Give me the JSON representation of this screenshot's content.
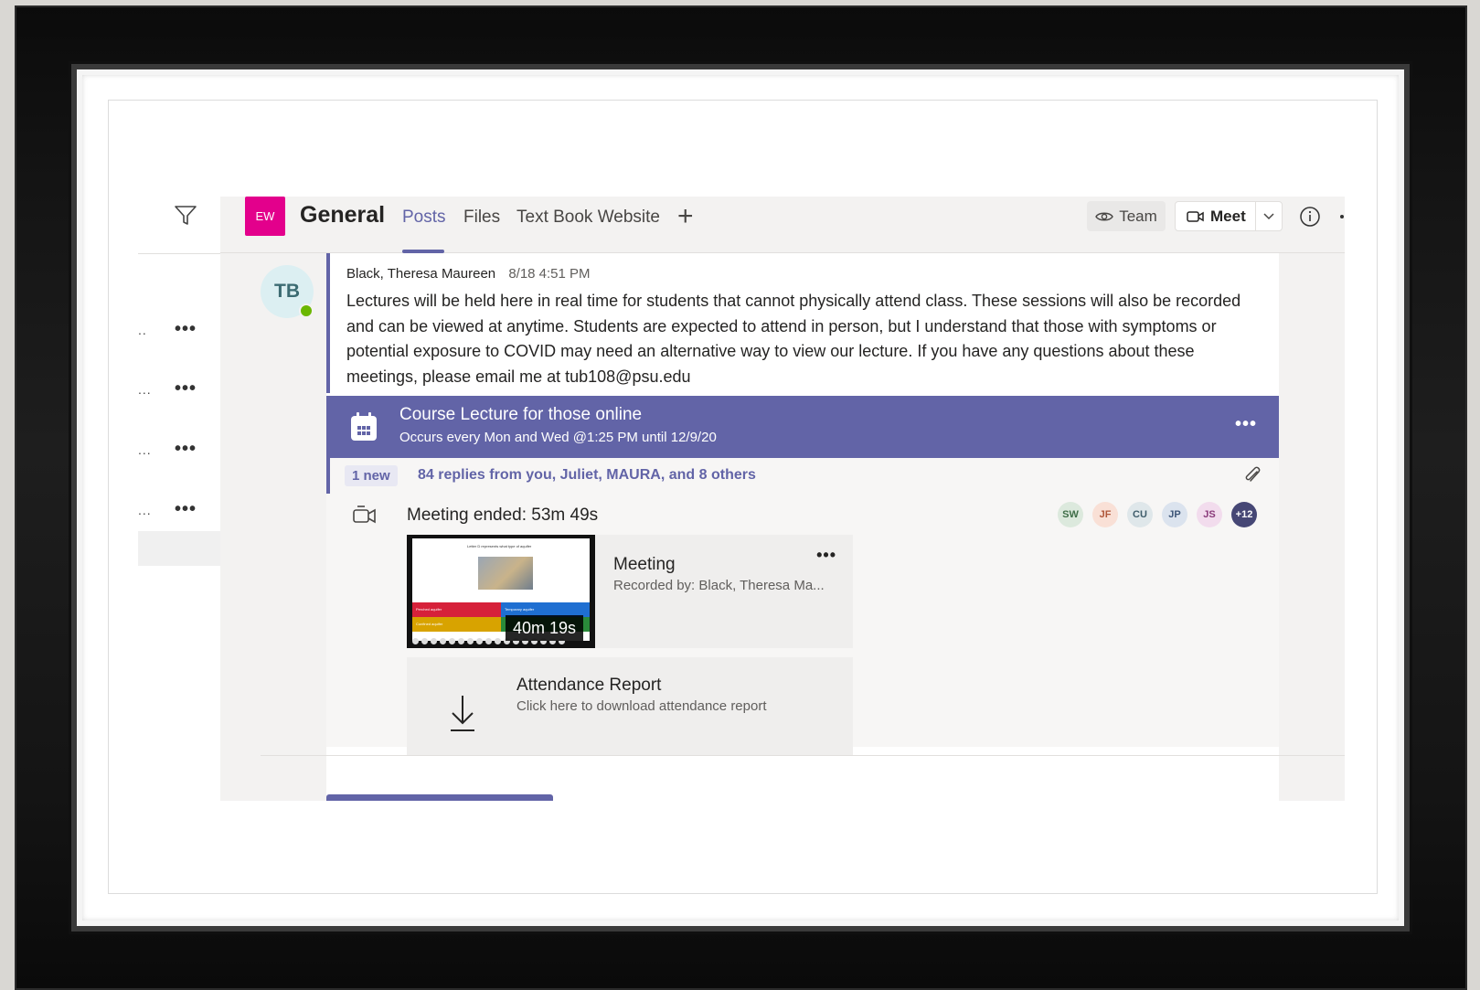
{
  "header": {
    "team_badge": "EW",
    "channel_title": "General",
    "tabs": [
      {
        "label": "Posts",
        "active": true
      },
      {
        "label": "Files",
        "active": false
      },
      {
        "label": "Text Book Website",
        "active": false
      }
    ],
    "team_label": "Team",
    "meet_label": "Meet"
  },
  "left_list": {
    "rows": [
      {
        "truncated": "..",
        "more": "•••"
      },
      {
        "truncated": "...",
        "more": "•••"
      },
      {
        "truncated": "...",
        "more": "•••"
      },
      {
        "truncated": "...",
        "more": "•••"
      }
    ]
  },
  "post": {
    "avatar_initials": "TB",
    "author": "Black, Theresa Maureen",
    "timestamp": "8/18 4:51 PM",
    "body": "Lectures will be held here in real time for students that cannot physically attend class. These sessions will also be recorded and can be viewed at anytime. Students are expected to attend in person, but I understand that those with symptoms or potential exposure to COVID may need an alternative way to view our lecture. If you have any questions about these meetings, please email me at tub108@psu.edu"
  },
  "lecture_card": {
    "title": "Course Lecture for those online",
    "subtitle": "Occurs every Mon and Wed @1:25 PM until 12/9/20",
    "more": "•••"
  },
  "replies": {
    "new_badge": "1 new",
    "summary": "84 replies from you, Juliet, MAURA, and 8 others"
  },
  "meeting": {
    "status": "Meeting ended: 53m 49s",
    "participants": [
      {
        "initials": "SW",
        "bg": "#dce9dd",
        "fg": "#3f6e48"
      },
      {
        "initials": "JF",
        "bg": "#f9e0d6",
        "fg": "#b0573a"
      },
      {
        "initials": "CU",
        "bg": "#dfe7ea",
        "fg": "#3f5d6b"
      },
      {
        "initials": "JP",
        "bg": "#dbe3ee",
        "fg": "#3d5678"
      },
      {
        "initials": "JS",
        "bg": "#f2dced",
        "fg": "#8a3a7a"
      },
      {
        "initials": "+12",
        "bg": "#464775",
        "fg": "#ffffff"
      }
    ],
    "recording": {
      "duration": "40m 19s",
      "title": "Meeting",
      "subtitle": "Recorded by: Black, Theresa Ma...",
      "more": "•••",
      "slide_title": "Letter D represents what type of aquifer",
      "options": [
        "Perched aquifer",
        "Temporary aquifer",
        "Confined aquifer",
        ""
      ]
    },
    "attendance": {
      "title": "Attendance Report",
      "subtitle": "Click here to download attendance report"
    }
  },
  "colors": {
    "brand": "#6264a7",
    "team_badge": "#e3008c",
    "presence": "#6bb700"
  }
}
